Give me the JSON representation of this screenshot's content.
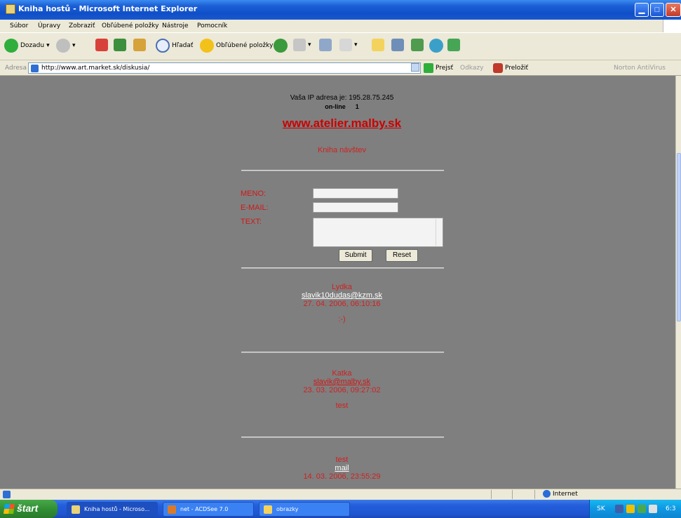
{
  "window": {
    "title": "Kniha hostů - Microsoft Internet Explorer",
    "min_label": "▁",
    "max_label": "□",
    "close_label": "✕"
  },
  "menu": [
    "Súbor",
    "Úpravy",
    "Zobraziť",
    "Obľúbené položky",
    "Nástroje",
    "Pomocník"
  ],
  "toolbar": {
    "back_label": "Dozadu",
    "search_label": "Hľadať",
    "favorites_label": "Obľúbené položky"
  },
  "address": {
    "label": "Adresa",
    "url": "http://www.art.market.sk/diskusia/",
    "go_label": "Prejsť",
    "links_label": "Odkazy",
    "translate_label": "Preložiť",
    "norton_label": "Norton AntiVirus"
  },
  "page": {
    "ip_text": "Vaša IP adresa je: 195.28.75.245",
    "online_label": "on-line",
    "online_count": "1",
    "site_link": "www.atelier.malby.sk",
    "guestbook_title": "Kniha návštev",
    "form": {
      "name_label": "MENO:",
      "email_label": "E-MAIL:",
      "text_label": "TEXT:",
      "submit_label": "Submit",
      "reset_label": "Reset"
    },
    "entries": [
      {
        "name": "Lydka",
        "email": "slavik10dudas@kzm.sk",
        "date": "27. 04. 2006, 06:10:16",
        "message": ":-)"
      },
      {
        "name": "Katka",
        "email": "slavik@malby.sk",
        "date": "23. 03. 2006, 09:27:02",
        "message": "test"
      },
      {
        "name": "test",
        "email": "mail",
        "date": "14. 03. 2006, 23:55:29",
        "message": ""
      }
    ]
  },
  "status": {
    "zone": "Internet"
  },
  "taskbar": {
    "start_label": "štart",
    "tasks": [
      "Kniha hostů - Microso...",
      "net - ACDSee 7.0",
      "obrazky"
    ],
    "lang": "SK",
    "clock": "6:3"
  }
}
